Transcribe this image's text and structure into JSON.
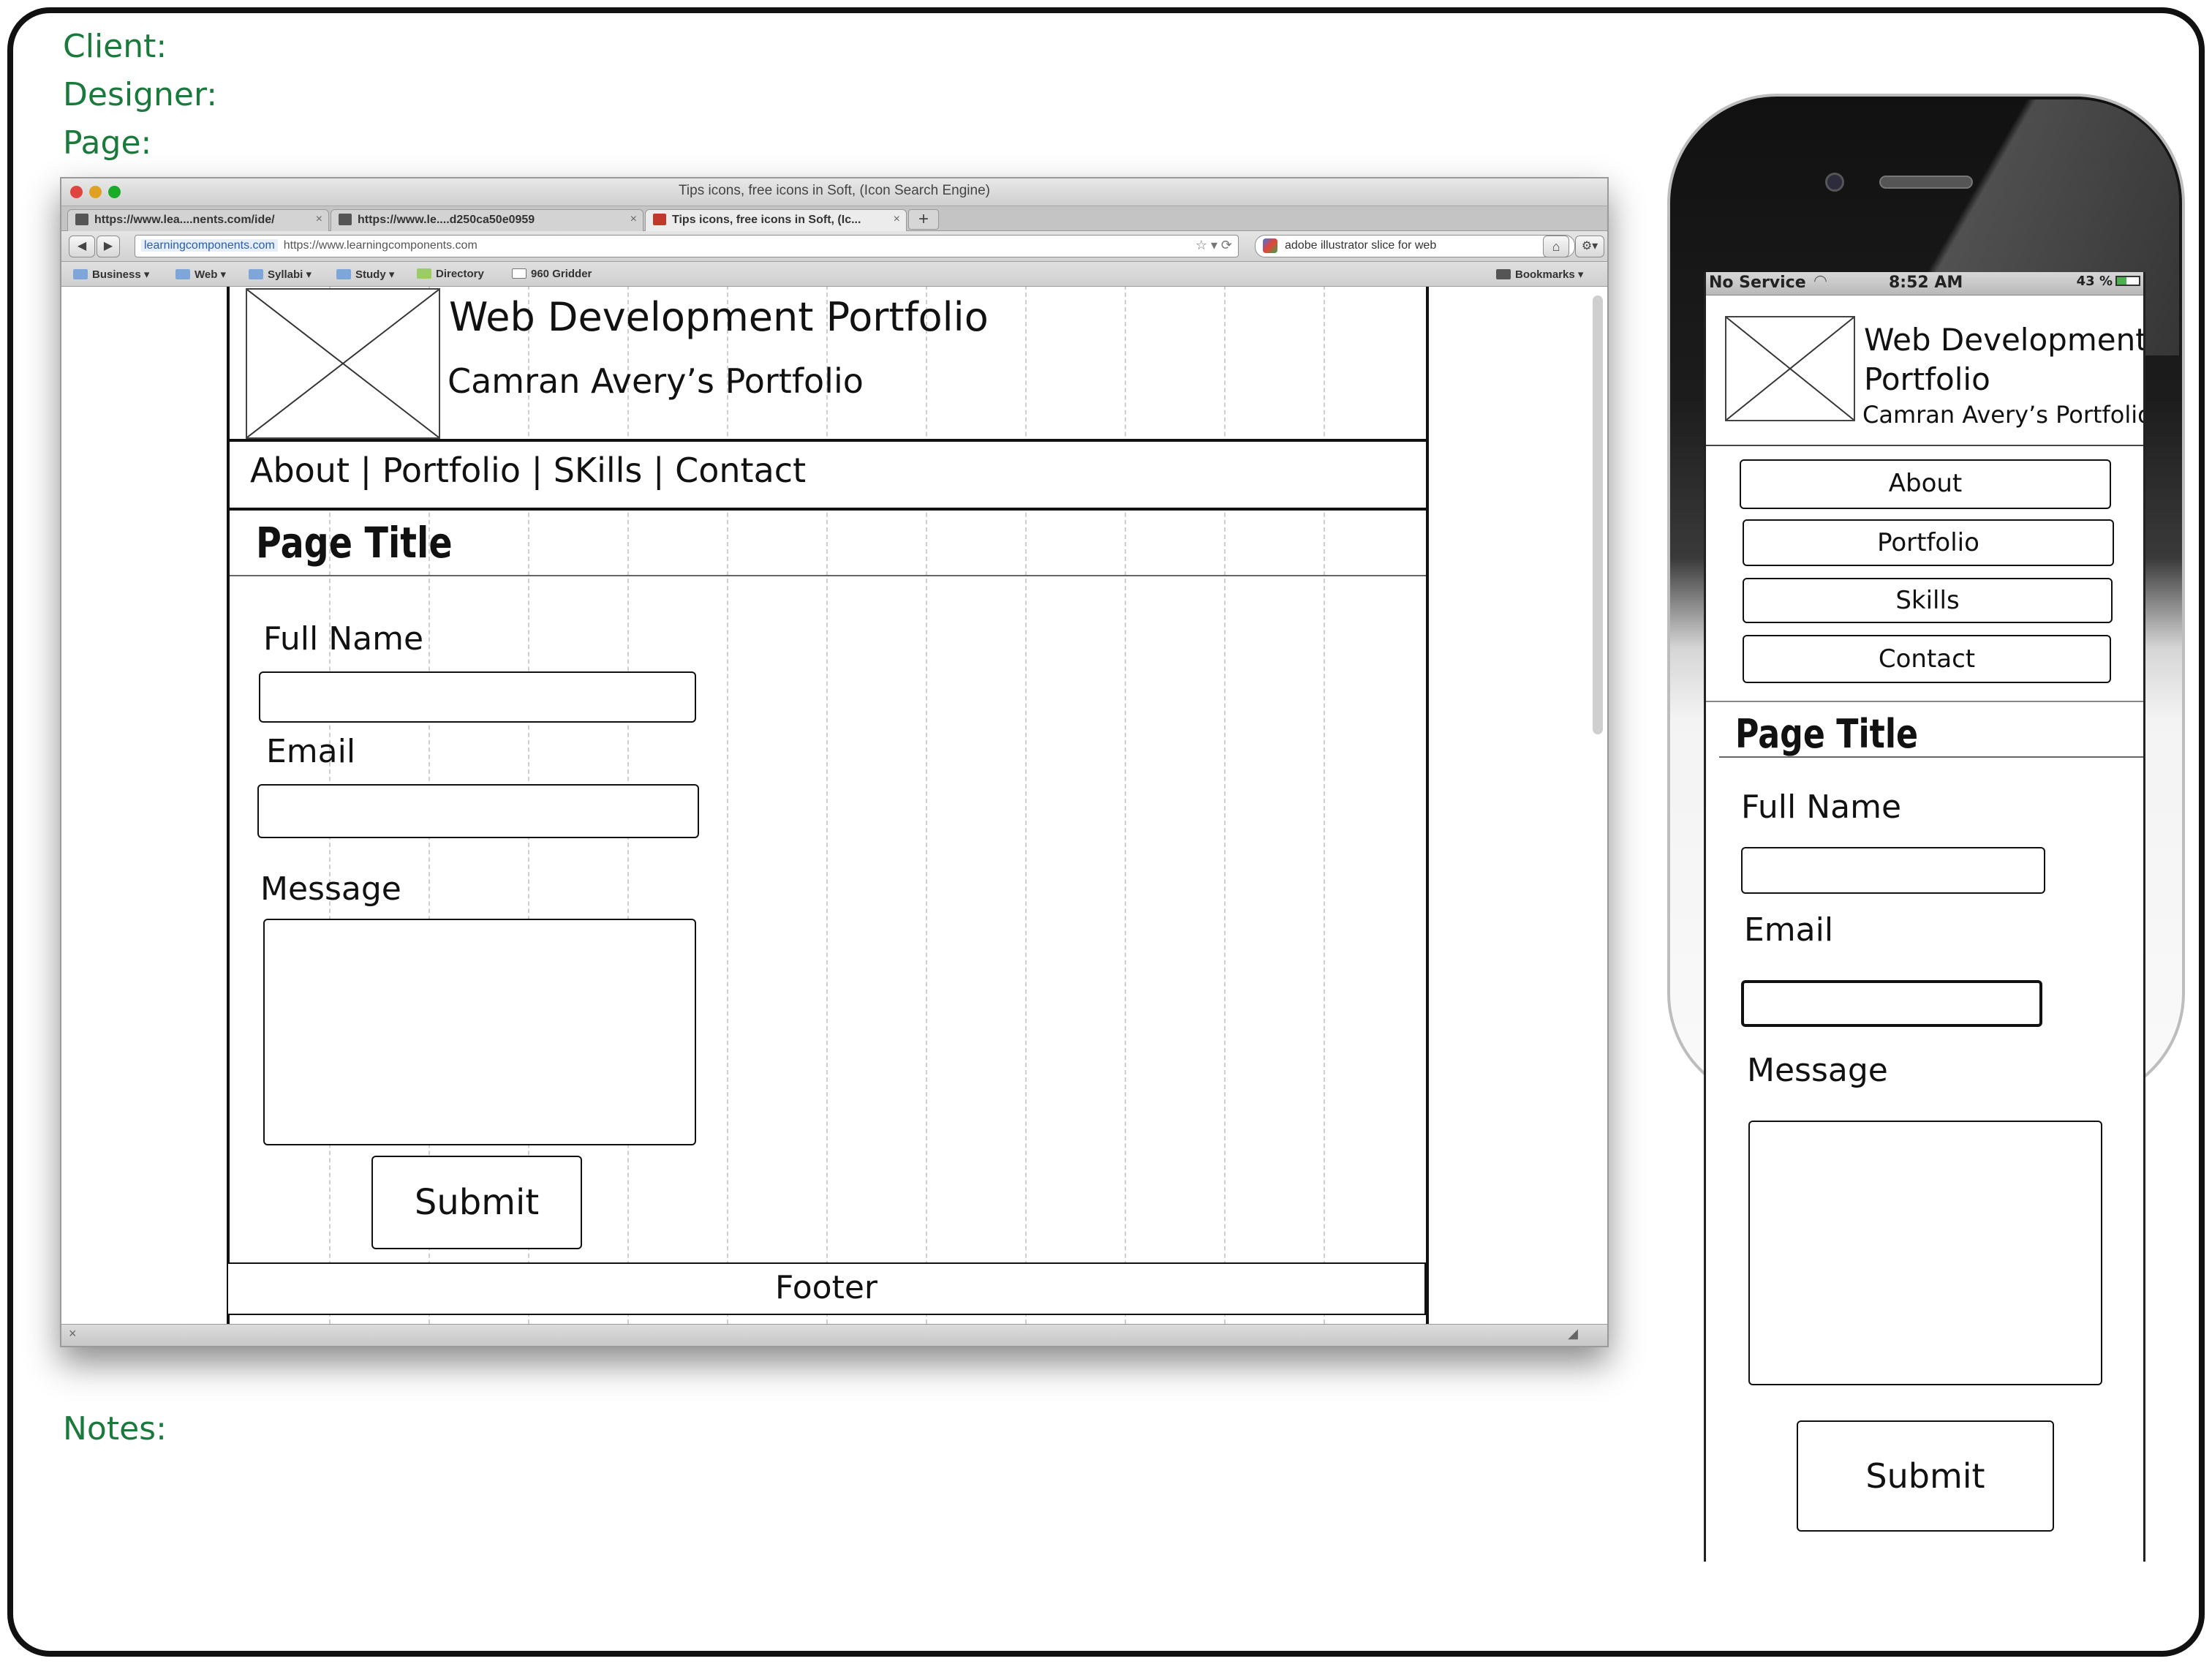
{
  "sheet": {
    "client_label": "Client:",
    "designer_label": "Designer:",
    "page_label": "Page:",
    "notes_label": "Notes:",
    "label_color": "#1a7a3c"
  },
  "browser": {
    "window_title": "Tips icons, free icons in Soft, (Icon Search Engine)",
    "tabs": [
      {
        "label": "https://www.lea....nents.com/ide/",
        "active": false
      },
      {
        "label": "https://www.le....d250ca50e0959",
        "active": false
      },
      {
        "label": "Tips icons, free icons in Soft, (Ic...",
        "active": true
      }
    ],
    "new_tab": "+",
    "url_site": "learningcomponents.com",
    "url_full": "https://www.learningcomponents.com",
    "search_value": "adobe illustrator slice for web",
    "bookmarks": [
      "Business ▾",
      "Web ▾",
      "Syllabi ▾",
      "Study ▾",
      "Directory",
      "960 Gridder"
    ],
    "bookmarks_menu": "Bookmarks ▾"
  },
  "desktop_wireframe": {
    "site_title": "Web Development Portfolio",
    "site_subtitle": "Camran Avery’s Portfolio",
    "nav_text": "About | Portfolio | SKills | Contact",
    "page_title": "Page Title",
    "fields": {
      "full_name_label": "Full Name",
      "email_label": "Email",
      "message_label": "Message"
    },
    "submit_label": "Submit",
    "footer_label": "Footer"
  },
  "phone": {
    "carrier": "No Service",
    "time": "8:52 AM",
    "battery": "43 %",
    "title_line1": "Web Development",
    "title_line2": "Portfolio",
    "subtitle": "Camran Avery’s Portfolio",
    "nav_buttons": [
      "About",
      "Portfolio",
      "Skills",
      "Contact"
    ],
    "page_title": "Page Title",
    "full_name_label": "Full Name",
    "email_label": "Email",
    "message_label": "Message",
    "submit_label": "Submit"
  }
}
